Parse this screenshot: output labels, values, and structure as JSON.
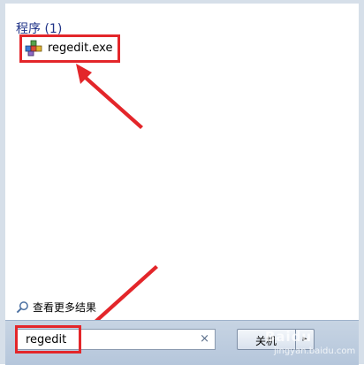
{
  "start_menu": {
    "results_header": "程序 (1)",
    "results": [
      {
        "label": "regedit.exe",
        "icon": "registry-editor-icon"
      }
    ],
    "more_results_label": "查看更多结果",
    "search": {
      "value": "regedit",
      "clear_glyph": "×"
    },
    "shutdown": {
      "label": "关机",
      "arrow_glyph": "▸"
    }
  },
  "annotation": {
    "color": "#e3262a"
  },
  "watermark": {
    "brand": "Baidu",
    "sub": "jingyan.baidu.com"
  }
}
